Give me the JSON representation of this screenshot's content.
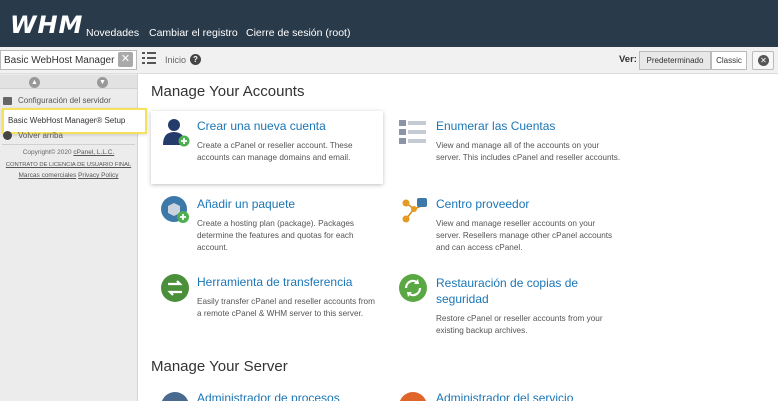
{
  "header": {
    "logo": "WHM",
    "nav": [
      "Novedades",
      "Cambiar el registro",
      "Cierre de sesión (root)"
    ]
  },
  "toolbar": {
    "search_value": "Basic WebHost Manager",
    "clear_label": "✕",
    "breadcrumb": "Inicio",
    "help_label": "?",
    "view_label": "Ver:",
    "view_options": [
      "Predeterminado",
      "Classic"
    ]
  },
  "sidebar": {
    "config_item": "Configuración del servidor",
    "dropdown_item": "Basic WebHost Manager® Setup",
    "back_item": "Volver arriba",
    "copyright": "Copyright© 2020",
    "copyright_link": "cPanel, L.L.C.",
    "license_link": "CONTRATO DE LICENCIA DE USUARIO FINAL",
    "trademarks_link": "Marcas comerciales",
    "privacy_link": "Privacy Policy"
  },
  "sections": {
    "accounts_title": "Manage Your Accounts",
    "server_title": "Manage Your Server"
  },
  "cards": [
    {
      "title": "Crear una nueva cuenta",
      "desc": "Create a cPanel or reseller account. These accounts can manage domains and email.",
      "icon": "user-add-icon"
    },
    {
      "title": "Enumerar las Cuentas",
      "desc": "View and manage all of the accounts on your server. This includes cPanel and reseller accounts.",
      "icon": "account-list-icon"
    },
    {
      "title": "Añadir un paquete",
      "desc": "Create a hosting plan (package). Packages determine the features and quotas for each account.",
      "icon": "package-add-icon"
    },
    {
      "title": "Centro proveedor",
      "desc": "View and manage reseller accounts on your server. Resellers manage other cPanel accounts and can access cPanel.",
      "icon": "reseller-center-icon"
    },
    {
      "title": "Herramienta de transferencia",
      "desc": "Easily transfer cPanel and reseller accounts from a remote cPanel & WHM server to this server.",
      "icon": "transfer-tool-icon"
    },
    {
      "title": "Restauración de copias de seguridad",
      "desc": "Restore cPanel or reseller accounts from your existing backup archives.",
      "icon": "backup-restore-icon"
    },
    {
      "title": "Administrador de procesos",
      "icon": "process-manager-icon"
    },
    {
      "title": "Administrador del servicio",
      "icon": "service-manager-icon"
    }
  ],
  "colors": {
    "header_bg": "#293a4a",
    "link": "#1b76b6",
    "highlight": "#f3e25a"
  }
}
